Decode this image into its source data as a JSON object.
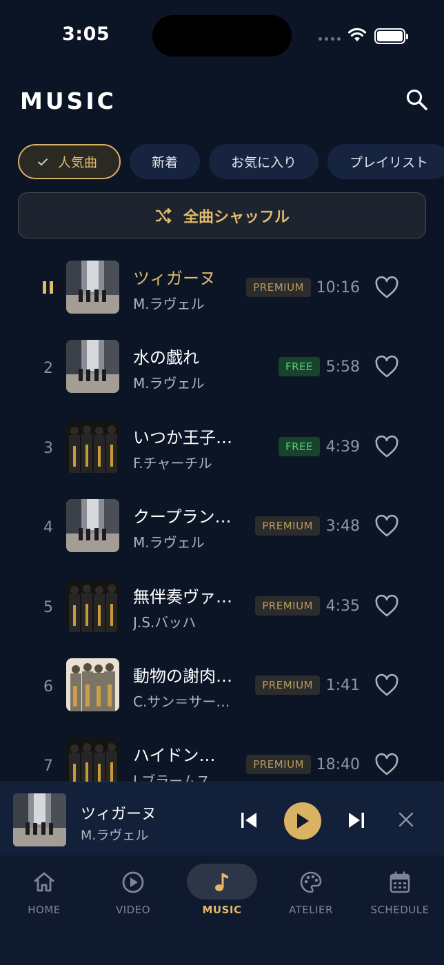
{
  "status": {
    "time": "3:05"
  },
  "header": {
    "title": "MUSIC"
  },
  "chips": [
    {
      "label": "人気曲",
      "active": true
    },
    {
      "label": "新着",
      "active": false
    },
    {
      "label": "お気に入り",
      "active": false
    },
    {
      "label": "プレイリスト",
      "active": false
    }
  ],
  "shuffle": {
    "label": "全曲シャッフル"
  },
  "tracks": [
    {
      "index": "",
      "title": "ツィガーヌ",
      "artist": "M.ラヴェル",
      "badge": "PREMIUM",
      "duration": "10:16",
      "playing": true,
      "art": "street"
    },
    {
      "index": "2",
      "title": "水の戯れ",
      "artist": "M.ラヴェル",
      "badge": "FREE",
      "duration": "5:58",
      "playing": false,
      "art": "street"
    },
    {
      "index": "3",
      "title": "いつか王子様が",
      "artist": "F.チャーチル",
      "badge": "FREE",
      "duration": "4:39",
      "playing": false,
      "art": "dark"
    },
    {
      "index": "4",
      "title": "クープラン…",
      "artist": "M.ラヴェル",
      "badge": "PREMIUM",
      "duration": "3:48",
      "playing": false,
      "art": "street"
    },
    {
      "index": "5",
      "title": "無伴奏ヴァ…",
      "artist": "J.S.バッハ",
      "badge": "PREMIUM",
      "duration": "4:35",
      "playing": false,
      "art": "dark"
    },
    {
      "index": "6",
      "title": "動物の謝肉…",
      "artist": "C.サン＝サー…",
      "badge": "PREMIUM",
      "duration": "1:41",
      "playing": false,
      "art": "light"
    },
    {
      "index": "7",
      "title": "ハイドン…",
      "artist": "J.ブラームス",
      "badge": "PREMIUM",
      "duration": "18:40",
      "playing": false,
      "art": "dark"
    }
  ],
  "now_playing": {
    "title": "ツィガーヌ",
    "artist": "M.ラヴェル"
  },
  "tabs": [
    {
      "label": "HOME",
      "icon": "home-icon",
      "active": false
    },
    {
      "label": "VIDEO",
      "icon": "play-circle-icon",
      "active": false
    },
    {
      "label": "MUSIC",
      "icon": "music-note-icon",
      "active": true
    },
    {
      "label": "ATELIER",
      "icon": "palette-icon",
      "active": false
    },
    {
      "label": "SCHEDULE",
      "icon": "calendar-icon",
      "active": false
    }
  ],
  "colors": {
    "accent": "#d9b262",
    "background": "#0b1526",
    "free": "#59d270"
  }
}
